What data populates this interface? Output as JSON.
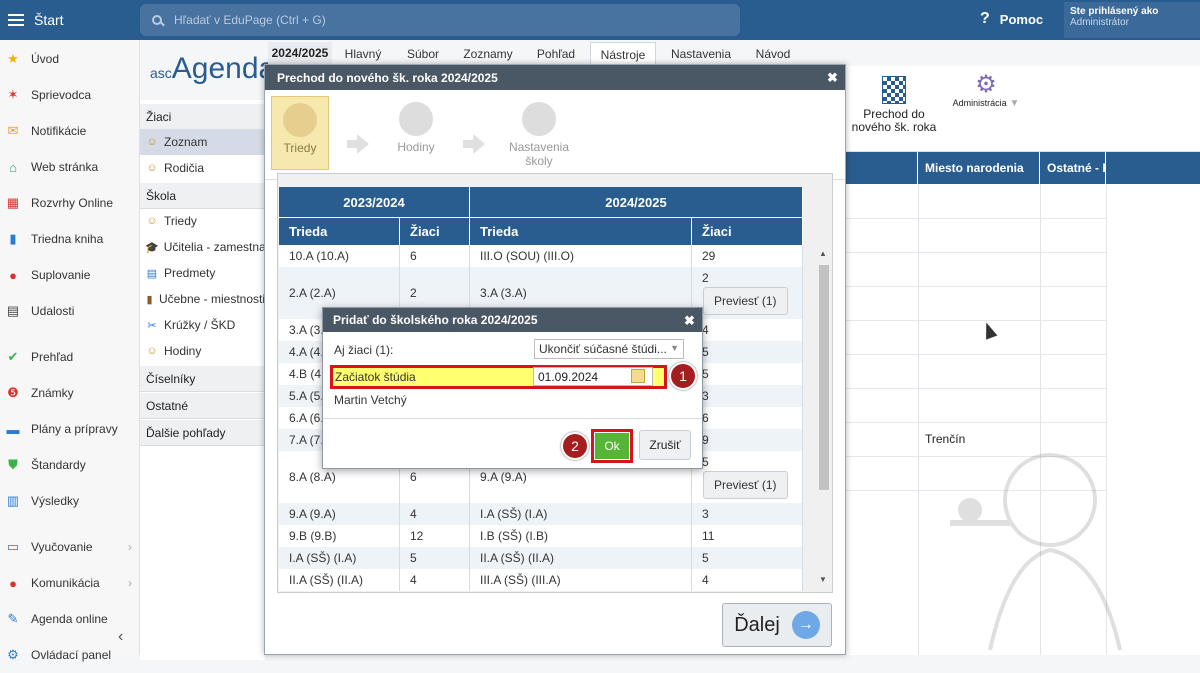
{
  "topbar": {
    "menu_label": "Štart",
    "search_placeholder": "Hľadať v EduPage (Ctrl + G)",
    "help_label": "Pomoc",
    "user_line1": "Ste prihlásený ako",
    "user_line2": "Administrátor"
  },
  "sidebar": {
    "items": [
      {
        "label": "Úvod",
        "icon": "star-icon"
      },
      {
        "label": "Sprievodca",
        "icon": "wand-icon"
      },
      {
        "label": "Notifikácie",
        "icon": "envelope-icon"
      },
      {
        "label": "Web stránka",
        "icon": "house-icon"
      },
      {
        "label": "Rozvrhy Online",
        "icon": "grid-icon"
      },
      {
        "label": "Triedna kniha",
        "icon": "book-icon"
      },
      {
        "label": "Suplovanie",
        "icon": "person-icon"
      },
      {
        "label": "Udalosti",
        "icon": "calendar-icon"
      },
      {
        "label": "Prehľad",
        "icon": "check-circle-icon"
      },
      {
        "label": "Známky",
        "icon": "grade-icon"
      },
      {
        "label": "Plány a prípravy",
        "icon": "briefcase-icon"
      },
      {
        "label": "Štandardy",
        "icon": "shield-icon"
      },
      {
        "label": "Výsledky",
        "icon": "bar-chart-icon"
      },
      {
        "label": "Vyučovanie",
        "icon": "open-book-icon"
      },
      {
        "label": "Komunikácia",
        "icon": "chat-icon"
      },
      {
        "label": "Agenda online",
        "icon": "pen-icon"
      },
      {
        "label": "Ovládací panel",
        "icon": "gear-icon"
      }
    ]
  },
  "submenu": {
    "logo": "Agenda",
    "logo_prefix": "asc",
    "zaci_header": "Žiaci",
    "zoznam": "Zoznam",
    "rodicia": "Rodičia",
    "skola_header": "Škola",
    "triedy": "Triedy",
    "ucitelia": "Učitelia - zamestnanci",
    "predmety": "Predmety",
    "ucebne": "Učebne - miestnosti",
    "kruzky": "Krúžky / ŠKD",
    "hodiny": "Hodiny",
    "ciselniky": "Číselníky",
    "ostatne": "Ostatné",
    "dalsie": "Ďalšie pohľady"
  },
  "tabs": {
    "year": "2024/2025",
    "items": [
      "Hlavný",
      "Súbor",
      "Zoznamy",
      "Pohľad",
      "Nástroje",
      "Nastavenia",
      "Návod"
    ],
    "active": "Nástroje"
  },
  "toolbar_right": {
    "prechod_label_1": "Prechod do",
    "prechod_label_2": "nového šk. roka",
    "admin_label": "Administrácia"
  },
  "grid": {
    "col1": "Miesto narodenia",
    "col2": "Ostatné - P",
    "row_city": "Trenčín"
  },
  "modal1": {
    "title": "Prechod do nového šk. roka 2024/2025",
    "steps": [
      {
        "label": "Triedy"
      },
      {
        "label": "Hodiny"
      },
      {
        "label": "Nastavenia školy"
      }
    ],
    "year_old": "2023/2024",
    "year_new": "2024/2025",
    "col_trieda": "Trieda",
    "col_ziaci": "Žiaci",
    "rows": [
      {
        "old": "10.A (10.A)",
        "old_n": "6",
        "new": "III.O (SOU) (III.O)",
        "new_n": "29"
      },
      {
        "old": "2.A (2.A)",
        "old_n": "2",
        "new": "3.A (3.A)",
        "new_n": "2"
      },
      {
        "old": "3.A (3.",
        "old_n": "",
        "new": "",
        "new_n": "4"
      },
      {
        "old": "4.A (4.",
        "old_n": "",
        "new": "",
        "new_n": "5"
      },
      {
        "old": "4.B (4.",
        "old_n": "",
        "new": "",
        "new_n": "5"
      },
      {
        "old": "5.A (5.",
        "old_n": "",
        "new": "",
        "new_n": "3"
      },
      {
        "old": "6.A (6.",
        "old_n": "",
        "new": "",
        "new_n": "6"
      },
      {
        "old": "7.A (7.",
        "old_n": "",
        "new": "",
        "new_n": "9"
      },
      {
        "old": "8.A (8.A)",
        "old_n": "6",
        "new": "9.A (9.A)",
        "new_n": "5"
      },
      {
        "old": "9.A (9.A)",
        "old_n": "4",
        "new": "I.A (SŠ) (I.A)",
        "new_n": "3"
      },
      {
        "old": "9.B (9.B)",
        "old_n": "12",
        "new": "I.B (SŠ) (I.B)",
        "new_n": "11"
      },
      {
        "old": "I.A (SŠ) (I.A)",
        "old_n": "5",
        "new": "II.A (SŠ) (II.A)",
        "new_n": "5"
      },
      {
        "old": "II.A (SŠ) (II.A)",
        "old_n": "4",
        "new": "III.A (SŠ) (III.A)",
        "new_n": "4"
      }
    ],
    "previest": "Previesť (1)",
    "next_label": "Ďalej"
  },
  "modal2": {
    "title": "Pridať do školského roka 2024/2025",
    "aj_ziaci_label": "Aj žiaci (1):",
    "aj_ziaci_value": "Ukončiť súčasné štúdi...",
    "zaciatok_label": "Začiatok štúdia",
    "zaciatok_value": "01.09.2024",
    "student_name": "Martin Vetchý",
    "ok_label": "Ok",
    "cancel_label": "Zrušiť",
    "badge1": "1",
    "badge2": "2"
  }
}
